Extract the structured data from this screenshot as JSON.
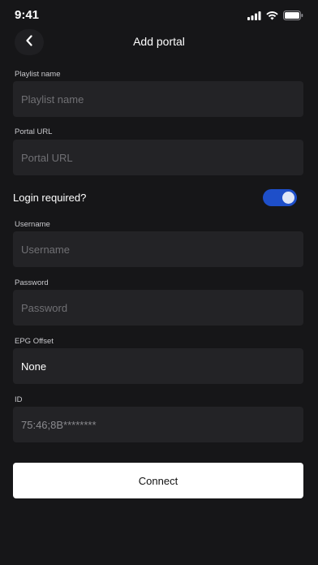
{
  "status_bar": {
    "time": "9:41",
    "icons": [
      "signal-icon",
      "wifi-icon",
      "battery-icon"
    ]
  },
  "header": {
    "title": "Add portal",
    "back_icon": "chevron-left-icon"
  },
  "form": {
    "playlist_name": {
      "label": "Playlist name",
      "placeholder": "Playlist name"
    },
    "portal_url": {
      "label": "Portal URL",
      "placeholder": "Portal URL"
    },
    "login_required": {
      "label": "Login required?",
      "enabled": true
    },
    "username": {
      "label": "Username",
      "placeholder": "Username"
    },
    "password": {
      "label": "Password",
      "placeholder": "Password"
    },
    "epg_offset": {
      "label": "EPG Offset",
      "value": "None"
    },
    "id": {
      "label": "ID",
      "value": "75:46;8B********"
    }
  },
  "connect_button": {
    "label": "Connect"
  },
  "colors": {
    "background": "#161618",
    "field": "#232326",
    "toggle_on": "#1e4fc9",
    "button": "#ffffff"
  }
}
